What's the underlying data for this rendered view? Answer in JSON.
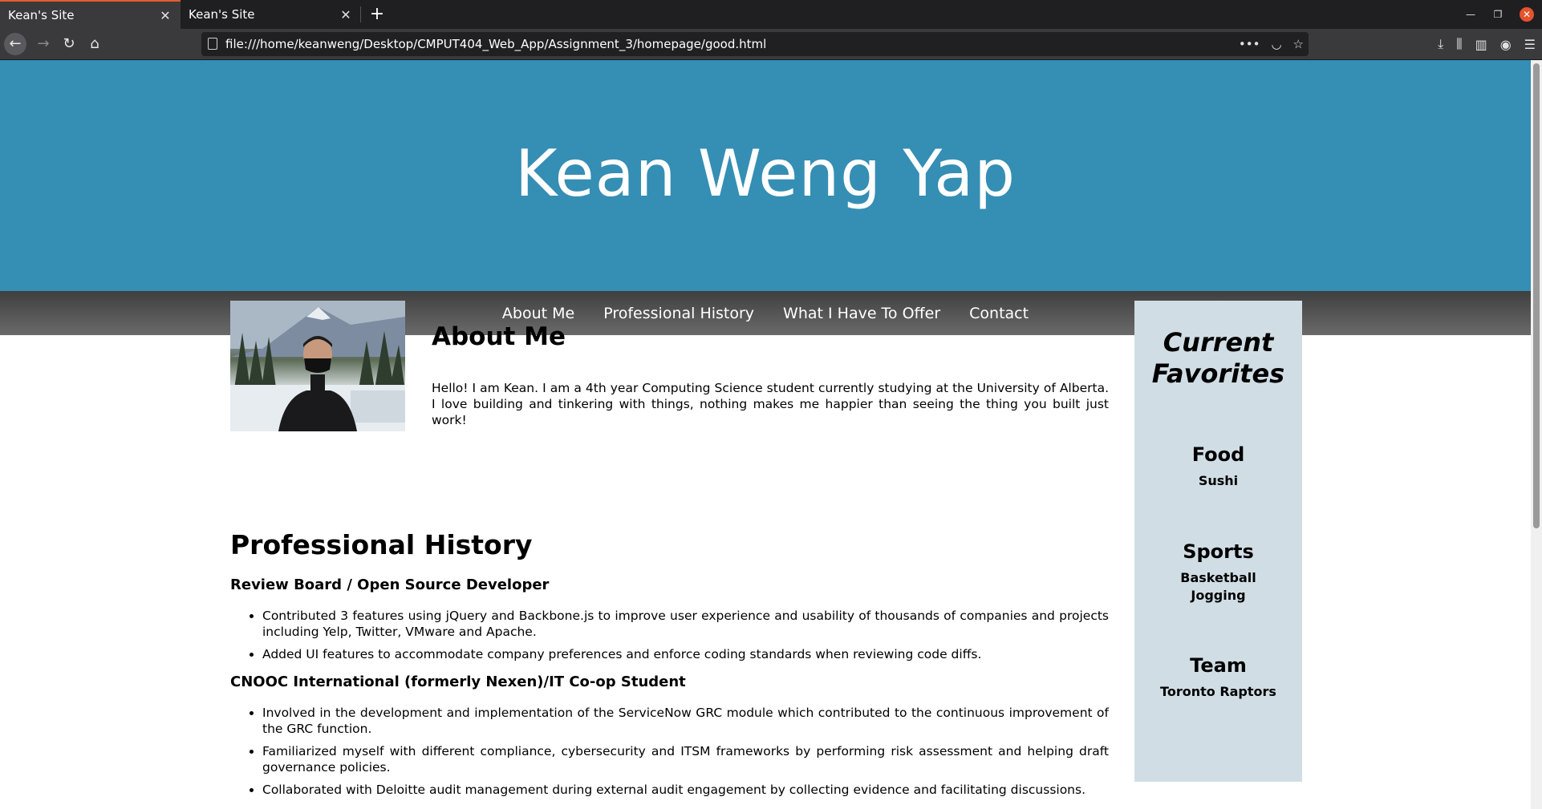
{
  "browser": {
    "tabs": [
      {
        "title": "Kean's Site",
        "active": true
      },
      {
        "title": "Kean's Site",
        "active": false
      }
    ],
    "url": "file:///home/keanweng/Desktop/CMPUT404_Web_App/Assignment_3/homepage/good.html",
    "accent_color": "#e35c2c"
  },
  "site": {
    "title": "Kean Weng Yap",
    "header_color": "#358eb3",
    "nav": [
      "About Me",
      "Professional History",
      "What I Have To Offer",
      "Contact"
    ]
  },
  "about": {
    "heading": "About Me",
    "text": "Hello! I am Kean. I am a 4th year Computing Science student currently studying at the University of Alberta. I love building and tinkering with things, nothing makes me happier than seeing the thing you built just work!"
  },
  "history": {
    "heading": "Professional History",
    "jobs": [
      {
        "title": "Review Board / Open Source Developer",
        "bullets": [
          "Contributed 3 features using jQuery and Backbone.js to improve user experience and usability of thousands of companies and projects including Yelp, Twitter, VMware and Apache.",
          "Added UI features to accommodate company preferences and enforce coding standards when reviewing code diffs."
        ]
      },
      {
        "title": "CNOOC International (formerly Nexen)/IT Co-op Student",
        "bullets": [
          "Involved in the development and implementation of the ServiceNow GRC module which contributed to the continuous improvement of the GRC function.",
          "Familiarized myself with different compliance, cybersecurity and ITSM frameworks by performing risk assessment and helping draft governance policies.",
          "Collaborated with Deloitte audit management during external audit engagement by collecting evidence and facilitating discussions."
        ]
      }
    ]
  },
  "sidebar": {
    "heading_line1": "Current",
    "heading_line2": "Favorites",
    "background": "#d0dde4",
    "favorites": [
      {
        "category": "Food",
        "items": [
          "Sushi"
        ]
      },
      {
        "category": "Sports",
        "items": [
          "Basketball",
          "Jogging"
        ]
      },
      {
        "category": "Team",
        "items": [
          "Toronto Raptors"
        ]
      }
    ]
  }
}
